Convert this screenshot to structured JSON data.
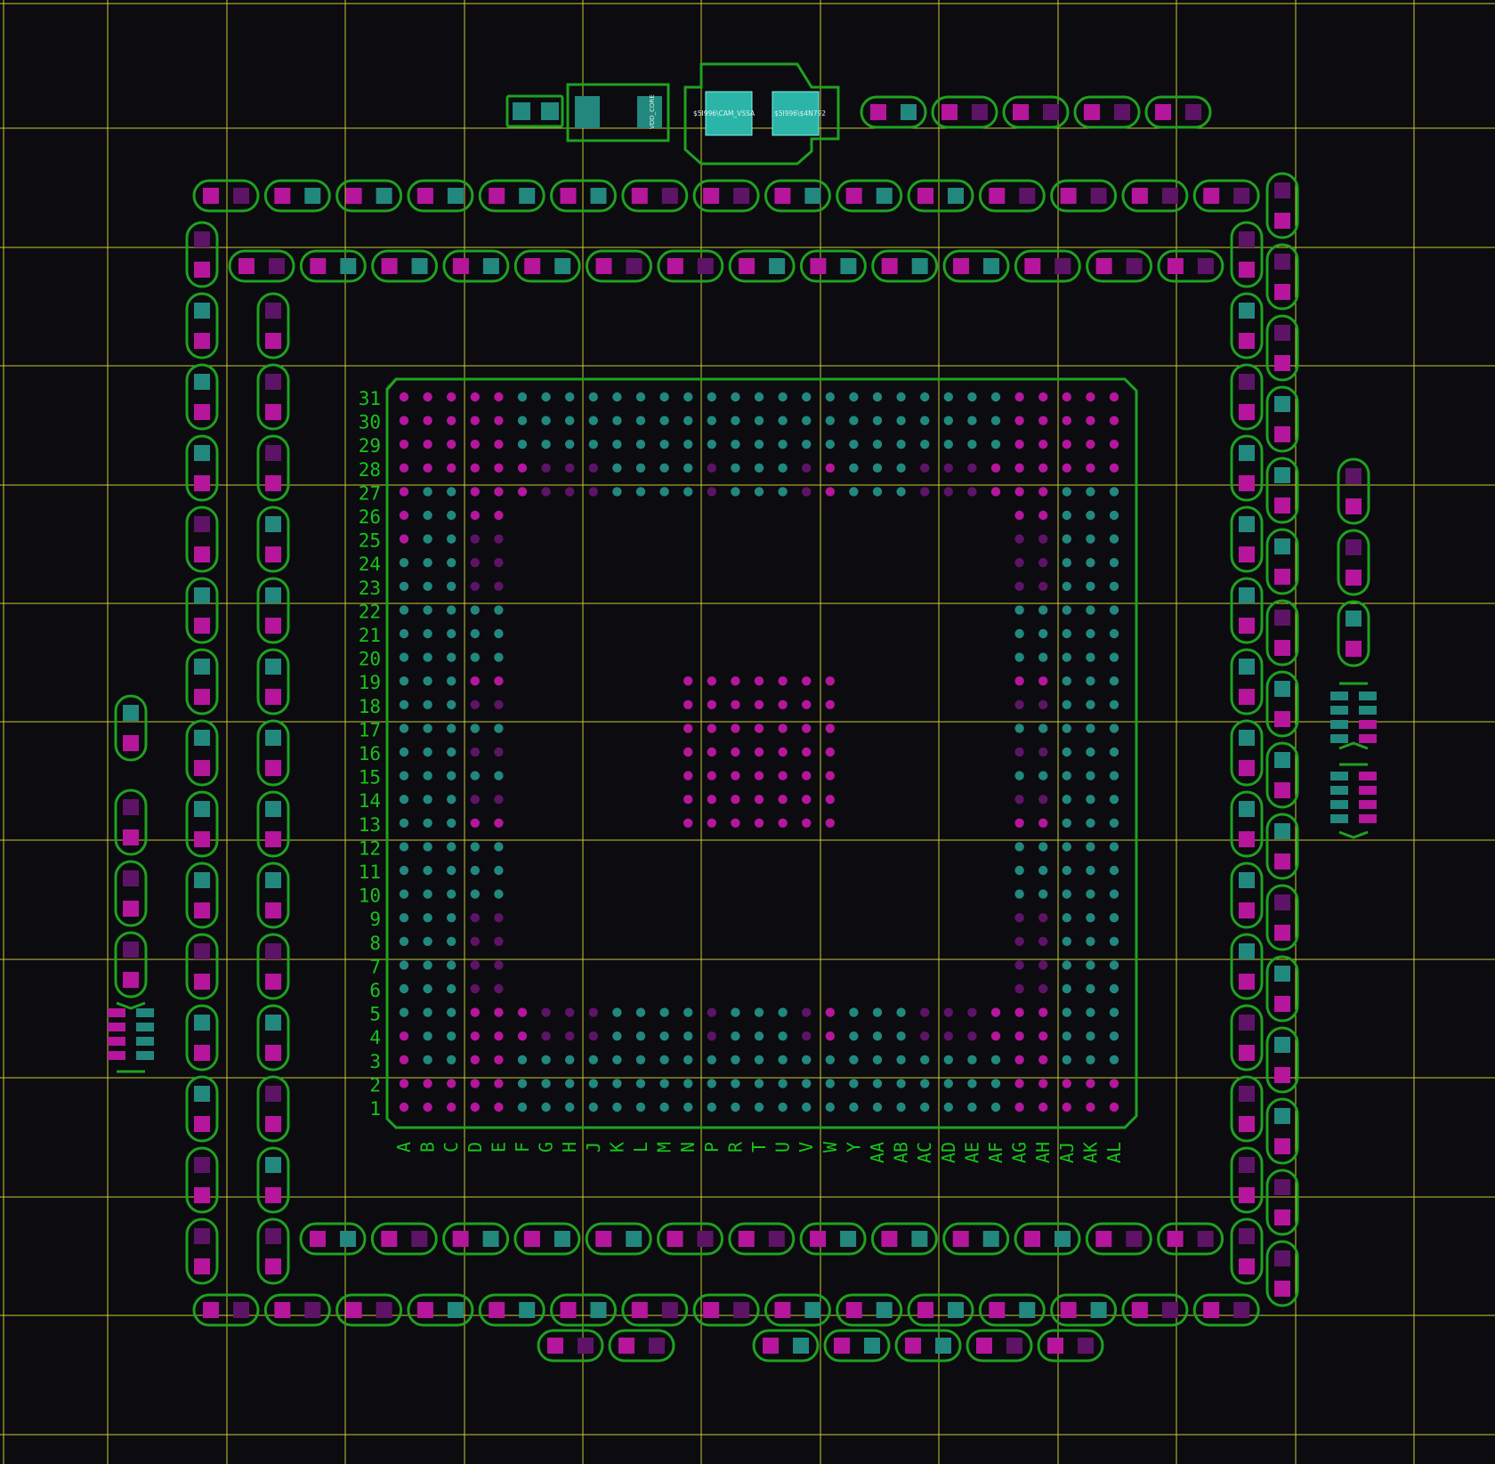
{
  "colors": {
    "background": "#0b0b10",
    "grid": "#c8c832",
    "outline": "#1fa21f",
    "net_magenta": "#b5169c",
    "net_dark": "#5e1466",
    "net_teal": "#22887e",
    "silk_text": "#19c419",
    "copper_highlight": "#2bb5a8"
  },
  "bga": {
    "columns": [
      "A",
      "B",
      "C",
      "D",
      "E",
      "F",
      "G",
      "H",
      "J",
      "K",
      "L",
      "M",
      "N",
      "P",
      "R",
      "T",
      "U",
      "V",
      "W",
      "Y",
      "AA",
      "AB",
      "AC",
      "AD",
      "AE",
      "AF",
      "AG",
      "AH",
      "AJ",
      "AK",
      "AL"
    ],
    "rows": [
      "31",
      "30",
      "29",
      "28",
      "27",
      "26",
      "25",
      "24",
      "23",
      "22",
      "21",
      "20",
      "19",
      "18",
      "17",
      "16",
      "15",
      "14",
      "13",
      "12",
      "11",
      "10",
      "9",
      "8",
      "7",
      "6",
      "5",
      "4",
      "3",
      "2",
      "1"
    ]
  },
  "components": {
    "top_part_label": "VDD_CORE",
    "inductor_pad_left_label": "$5I996\\CAM_VSSA",
    "inductor_pad_right_label": "$5I996\\$4N792"
  }
}
